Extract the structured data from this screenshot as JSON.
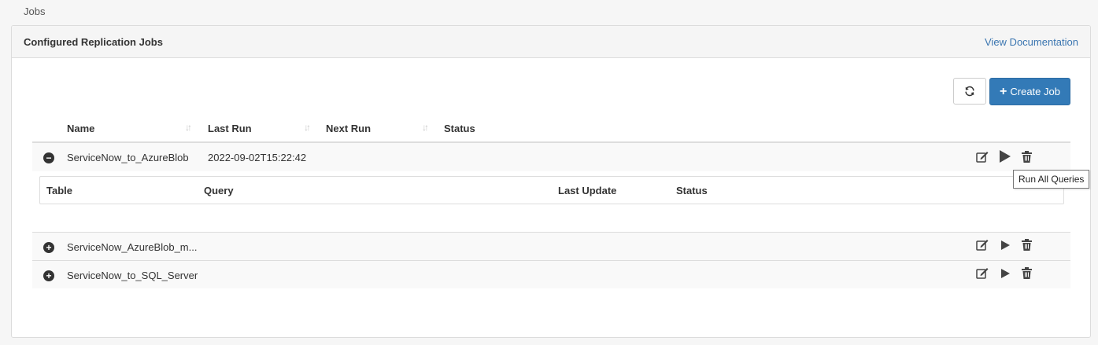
{
  "breadcrumb": "Jobs",
  "panel": {
    "title": "Configured Replication Jobs",
    "doc_link": "View Documentation"
  },
  "toolbar": {
    "refresh_icon": "refresh-icon",
    "create_label": "Create Job",
    "create_icon": "plus-icon"
  },
  "table": {
    "columns": [
      "Name",
      "Last Run",
      "Next Run",
      "Status"
    ],
    "rows": [
      {
        "name": "ServiceNow_to_AzureBlob",
        "last_run": "2022-09-02T15:22:42",
        "next_run": "",
        "status": "",
        "expanded": true
      },
      {
        "name": "ServiceNow_AzureBlob_m...",
        "last_run": "",
        "next_run": "",
        "status": "",
        "expanded": false
      },
      {
        "name": "ServiceNow_to_SQL_Server",
        "last_run": "",
        "next_run": "",
        "status": "",
        "expanded": false
      }
    ]
  },
  "sub_table": {
    "columns": [
      "Table",
      "Query",
      "Last Update",
      "Status"
    ]
  },
  "tooltip": "Run All Queries",
  "colors": {
    "primary": "#337ab7",
    "link": "#3a75b0",
    "icon": "#444444"
  }
}
